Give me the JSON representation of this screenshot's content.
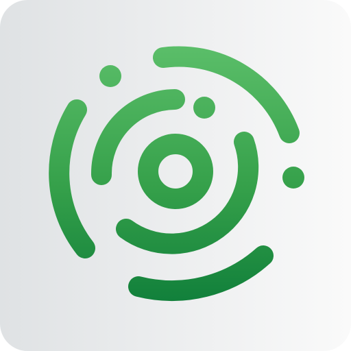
{
  "icon": {
    "name": "circular-arcs-target-logo",
    "colors": {
      "background_start": "#dfe2e4",
      "background_end": "#fafafa",
      "green_light": "#5cbf6a",
      "green_mid": "#35a04a",
      "green_dark": "#0f7e3a"
    }
  }
}
